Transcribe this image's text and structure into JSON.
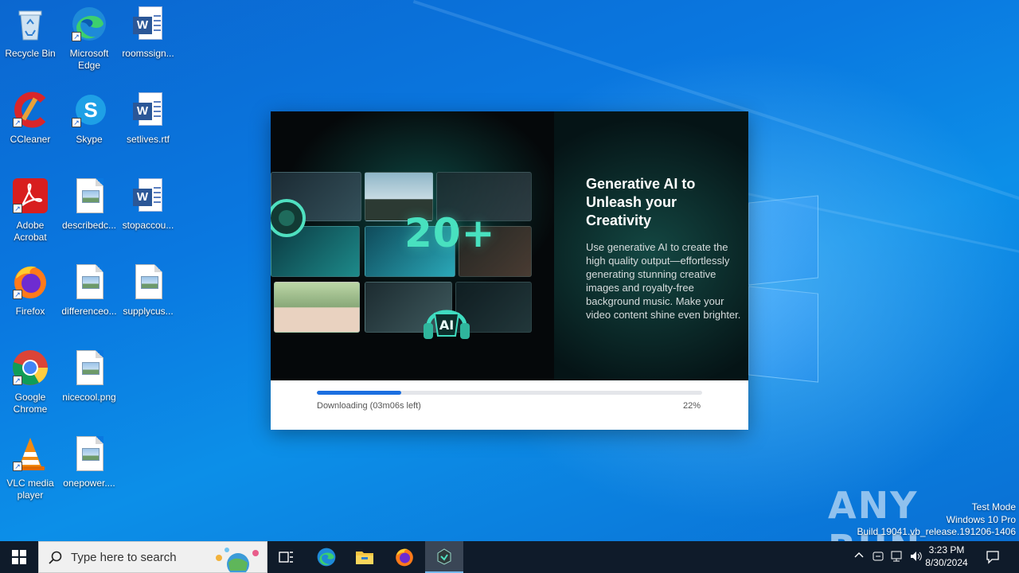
{
  "desktop": {
    "icons": [
      {
        "label": "Recycle Bin",
        "icon": "recycle-bin-icon"
      },
      {
        "label": "Microsoft Edge",
        "icon": "edge-icon"
      },
      {
        "label": "roomssign...",
        "icon": "word-document-icon"
      },
      {
        "label": "CCleaner",
        "icon": "ccleaner-icon"
      },
      {
        "label": "Skype",
        "icon": "skype-icon"
      },
      {
        "label": "setlives.rtf",
        "icon": "word-document-icon"
      },
      {
        "label": "Adobe Acrobat",
        "icon": "adobe-acrobat-icon"
      },
      {
        "label": "describedc...",
        "icon": "image-file-icon"
      },
      {
        "label": "stopaccou...",
        "icon": "word-document-icon"
      },
      {
        "label": "Firefox",
        "icon": "firefox-icon"
      },
      {
        "label": "differenceo...",
        "icon": "image-file-icon"
      },
      {
        "label": "supplycus...",
        "icon": "image-file-icon"
      },
      {
        "label": "Google Chrome",
        "icon": "chrome-icon"
      },
      {
        "label": "nicecool.png",
        "icon": "image-file-icon"
      },
      {
        "label": "VLC media player",
        "icon": "vlc-icon"
      },
      {
        "label": "onepower....",
        "icon": "image-file-icon"
      }
    ]
  },
  "installer": {
    "banner": {
      "big_number": "20+",
      "badge_text": "AI",
      "headline": "Generative AI to Unleash your Creativity",
      "description": "Use generative AI to create the high quality output—effortlessly generating stunning creative images and royalty-free background music. Make your video content shine even brighter."
    },
    "progress": {
      "status": "Downloading (03m06s left)",
      "percent_label": "22%",
      "fraction": 0.22,
      "accent": "#1b6fe0"
    }
  },
  "watermark": {
    "logo_text": "ANY RUN",
    "mode": "Test Mode",
    "edition": "Windows 10 Pro",
    "build": "Build 19041.vb_release.191206-1406"
  },
  "taskbar": {
    "search_placeholder": "Type here to search",
    "apps": [
      "task-view-icon",
      "edge-icon",
      "file-explorer-icon",
      "firefox-icon",
      "installer-app-icon"
    ],
    "clock": {
      "time": "3:23 PM",
      "date": "8/30/2024"
    }
  }
}
